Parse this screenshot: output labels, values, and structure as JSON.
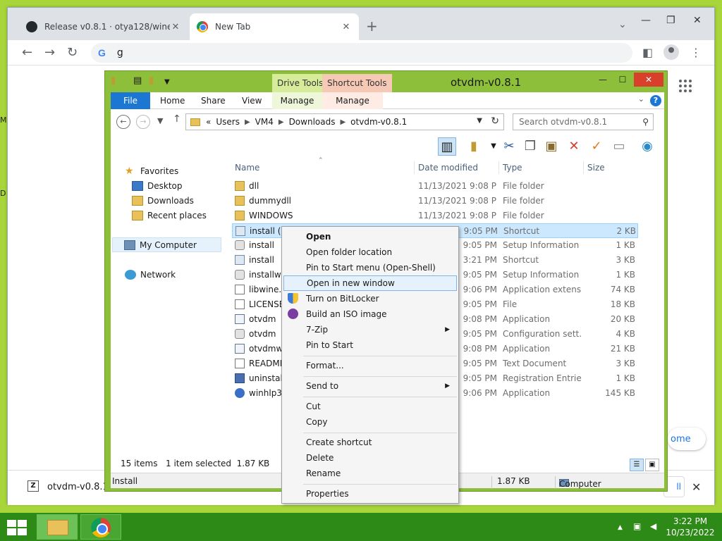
{
  "browser": {
    "tabs": [
      {
        "label": "Release v0.8.1 · otya128/winevdm"
      },
      {
        "label": "New Tab"
      }
    ],
    "tab_close_glyph": "✕",
    "new_tab_glyph": "+",
    "window_buttons": {
      "minimize": "—",
      "maximize": "❐",
      "close": "✕"
    },
    "omnibox_value": "g",
    "omnibox_google_letter": "G",
    "home_link_text": "ome",
    "download": {
      "badge": "Z",
      "filename": "otvdm-v0.8.1.z",
      "show_all": "ll",
      "close": "✕"
    }
  },
  "desktop": {
    "edge_letters": [
      "M",
      "D"
    ]
  },
  "explorer": {
    "title": "otvdm-v0.8.1",
    "context_tabs": {
      "drive_tools": "Drive Tools",
      "shortcut_tools": "Shortcut Tools"
    },
    "ribbon_tabs": [
      {
        "label": "File"
      },
      {
        "label": "Home"
      },
      {
        "label": "Share"
      },
      {
        "label": "View"
      },
      {
        "label": "Manage"
      },
      {
        "label": "Manage"
      }
    ],
    "help": "?",
    "window_buttons": {
      "minimize": "—",
      "maximize": "☐",
      "close": "✕"
    },
    "breadcrumb": {
      "prefix": "«",
      "items": [
        "Users",
        "VM4",
        "Downloads",
        "otvdm-v0.8.1"
      ]
    },
    "search_placeholder": "Search otvdm-v0.8.1",
    "columns": {
      "name": "Name",
      "date": "Date modified",
      "type": "Type",
      "size": "Size"
    },
    "nav": {
      "favorites": "Favorites",
      "desktop": "Desktop",
      "downloads": "Downloads",
      "recent": "Recent places",
      "computer": "My Computer",
      "network": "Network"
    },
    "files": [
      {
        "name": "dll",
        "date": "11/13/2021 9:08 PM",
        "type": "File folder",
        "size": ""
      },
      {
        "name": "dummydll",
        "date": "11/13/2021 9:08 PM",
        "type": "File folder",
        "size": ""
      },
      {
        "name": "WINDOWS",
        "date": "11/13/2021 9:08 PM",
        "type": "File folder",
        "size": ""
      },
      {
        "name": "install (n",
        "date": "9:05 PM",
        "type": "Shortcut",
        "size": "2 KB"
      },
      {
        "name": "install",
        "date": "9:05 PM",
        "type": "Setup Information",
        "size": "1 KB"
      },
      {
        "name": "install",
        "date": "3:21 PM",
        "type": "Shortcut",
        "size": "3 KB"
      },
      {
        "name": "installw",
        "date": "9:05 PM",
        "type": "Setup Information",
        "size": "1 KB"
      },
      {
        "name": "libwine.c",
        "date": "9:06 PM",
        "type": "Application extens...",
        "size": "74 KB"
      },
      {
        "name": "LICENSE",
        "date": "9:05 PM",
        "type": "File",
        "size": "18 KB"
      },
      {
        "name": "otvdm",
        "date": "9:08 PM",
        "type": "Application",
        "size": "20 KB"
      },
      {
        "name": "otvdm",
        "date": "9:05 PM",
        "type": "Configuration sett...",
        "size": "4 KB"
      },
      {
        "name": "otvdmw",
        "date": "9:08 PM",
        "type": "Application",
        "size": "21 KB"
      },
      {
        "name": "README",
        "date": "9:05 PM",
        "type": "Text Document",
        "size": "3 KB"
      },
      {
        "name": "uninstall",
        "date": "9:05 PM",
        "type": "Registration Entries",
        "size": "1 KB"
      },
      {
        "name": "winhlp32",
        "date": "9:06 PM",
        "type": "Application",
        "size": "145 KB"
      }
    ],
    "status": {
      "items": "15 items",
      "selected": "1 item selected  1.87 KB"
    },
    "details_bar": {
      "name": "Install",
      "size": "1.87 KB",
      "location": "Computer"
    }
  },
  "context_menu": {
    "items": [
      {
        "label": "Open"
      },
      {
        "label": "Open folder location"
      },
      {
        "label": "Pin to Start menu (Open-Shell)"
      },
      {
        "label": "Open in new window"
      },
      {
        "label": "Turn on BitLocker"
      },
      {
        "label": "Build an ISO image"
      },
      {
        "label": "7-Zip"
      },
      {
        "label": "Pin to Start"
      },
      {
        "label": "Format..."
      },
      {
        "label": "Send to"
      },
      {
        "label": "Cut"
      },
      {
        "label": "Copy"
      },
      {
        "label": "Create shortcut"
      },
      {
        "label": "Delete"
      },
      {
        "label": "Rename"
      },
      {
        "label": "Properties"
      }
    ],
    "submenu_arrow": "▶"
  },
  "taskbar": {
    "clock_time": "3:22 PM",
    "clock_date": "10/23/2022",
    "tray_icons": [
      "up-chevron-icon",
      "network-icon",
      "volume-icon"
    ]
  },
  "colors": {
    "desktop": "#a8d63a",
    "taskbar": "#2e8a17",
    "explorer_frame": "#8dbf3b",
    "file_tab": "#1c77d2",
    "close_button": "#d8402b",
    "selection": "#cce8ff"
  }
}
